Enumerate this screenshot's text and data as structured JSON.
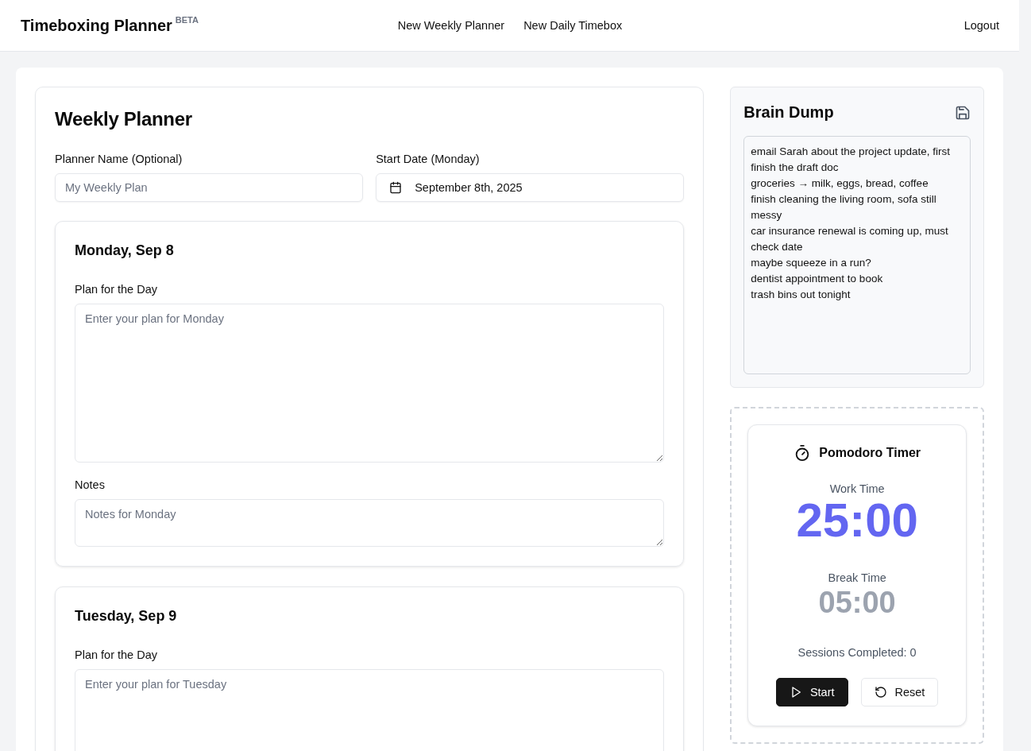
{
  "header": {
    "brand": "Timeboxing Planner",
    "badge": "BETA",
    "nav": [
      "New Weekly Planner",
      "New Daily Timebox"
    ],
    "logout": "Logout"
  },
  "planner": {
    "title": "Weekly Planner",
    "name_label": "Planner Name (Optional)",
    "name_placeholder": "My Weekly Plan",
    "date_label": "Start Date (Monday)",
    "date_value": "September 8th, 2025",
    "days": [
      {
        "title": "Monday, Sep 8",
        "plan_label": "Plan for the Day",
        "plan_placeholder": "Enter your plan for Monday",
        "notes_label": "Notes",
        "notes_placeholder": "Notes for Monday"
      },
      {
        "title": "Tuesday, Sep 9",
        "plan_label": "Plan for the Day",
        "plan_placeholder": "Enter your plan for Tuesday"
      }
    ]
  },
  "brain_dump": {
    "title": "Brain Dump",
    "value": "email Sarah about the project update, first finish the draft doc\ngroceries → milk, eggs, bread, coffee\nfinish cleaning the living room, sofa still messy\ncar insurance renewal is coming up, must check date\nmaybe squeeze in a run?\ndentist appointment to book\ntrash bins out tonight"
  },
  "pomodoro": {
    "title": "Pomodoro Timer",
    "timers": [
      {
        "label": "Work Time",
        "time": "25:00",
        "selected": true
      },
      {
        "label": "Break Time",
        "time": "05:00",
        "selected": false
      }
    ],
    "sessions": "Sessions Completed: 0",
    "buttons": [
      {
        "kind": "start",
        "label": "Start"
      },
      {
        "kind": "reset",
        "label": "Reset"
      }
    ]
  }
}
